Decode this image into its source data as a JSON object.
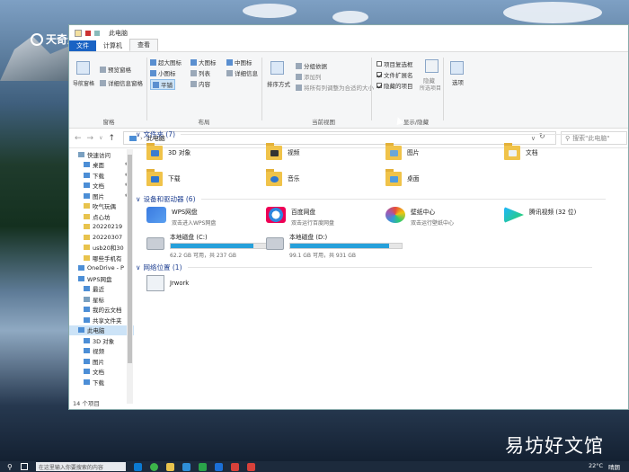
{
  "watermark_top": "天奇生活",
  "watermark_bottom": "易坊好文馆",
  "window": {
    "title": "此电脑",
    "tabs": [
      "文件",
      "计算机",
      "查看"
    ],
    "status": "14 个项目"
  },
  "ribbon": {
    "nav_pane": "导航窗格",
    "preview_pane": "预览窗格",
    "details_pane": "详细信息窗格",
    "group_panes": "窗格",
    "layouts": [
      "超大图标",
      "大图标",
      "中图标",
      "小图标",
      "列表",
      "详细信息",
      "平铺",
      "内容"
    ],
    "group_layout": "布局",
    "sort_by": "排序方式",
    "group_by": "分组依据",
    "add_columns": "添加列",
    "fit_columns": "将所有列调整为合适的大小",
    "group_current_view": "当前视图",
    "item_checkboxes": "项目复选框",
    "file_extensions": "文件扩展名",
    "hidden_items": "隐藏的项目",
    "hide_selected": "隐藏",
    "hide_selected_sub": "所选项目",
    "options": "选项",
    "group_show_hide": "显示/隐藏",
    "checks": {
      "item_checkboxes": false,
      "file_extensions": true,
      "hidden_items": true
    }
  },
  "address": {
    "path": "此电脑",
    "search_placeholder": "搜索\"此电脑\""
  },
  "sidebar": [
    {
      "label": "快速访问",
      "icon": "star-icon",
      "level": 1
    },
    {
      "label": "桌面",
      "icon": "desktop-icon",
      "level": 2,
      "pin": true
    },
    {
      "label": "下载",
      "icon": "download-icon",
      "level": 2,
      "pin": true
    },
    {
      "label": "文档",
      "icon": "document-icon",
      "level": 2,
      "pin": true
    },
    {
      "label": "图片",
      "icon": "picture-icon",
      "level": 2,
      "pin": true
    },
    {
      "label": "吹气玩偶",
      "icon": "folder-icon",
      "level": 2
    },
    {
      "label": "点心坊",
      "icon": "folder-icon",
      "level": 2
    },
    {
      "label": "20220219",
      "icon": "folder-icon",
      "level": 2
    },
    {
      "label": "20220307",
      "icon": "folder-icon",
      "level": 2
    },
    {
      "label": "usb20和30",
      "icon": "folder-icon",
      "level": 2
    },
    {
      "label": "哪些手机有",
      "icon": "folder-icon",
      "level": 2
    },
    {
      "label": "OneDrive - P",
      "icon": "cloud-icon",
      "level": 1
    },
    {
      "label": "WPS网盘",
      "icon": "cloud-icon",
      "level": 1
    },
    {
      "label": "最近",
      "icon": "clock-icon",
      "level": 2
    },
    {
      "label": "星标",
      "icon": "star-icon",
      "level": 2
    },
    {
      "label": "我的云文档",
      "icon": "cloud-doc-icon",
      "level": 2
    },
    {
      "label": "共享文件夹",
      "icon": "share-icon",
      "level": 2
    },
    {
      "label": "此电脑",
      "icon": "computer-icon",
      "level": 1,
      "selected": true
    },
    {
      "label": "3D 对象",
      "icon": "cube-icon",
      "level": 2
    },
    {
      "label": "视频",
      "icon": "video-icon",
      "level": 2
    },
    {
      "label": "图片",
      "icon": "picture-icon",
      "level": 2
    },
    {
      "label": "文档",
      "icon": "document-icon",
      "level": 2
    },
    {
      "label": "下载",
      "icon": "download-icon",
      "level": 2
    }
  ],
  "sections": {
    "folders": "文件夹 (7)",
    "devices": "设备和驱动器 (6)",
    "network": "网络位置 (1)"
  },
  "folders": [
    "3D 对象",
    "视频",
    "图片",
    "文档",
    "下载",
    "音乐",
    "桌面"
  ],
  "devices": [
    {
      "name": "WPS网盘",
      "sub": "双击进入WPS网盘"
    },
    {
      "name": "百度网盘",
      "sub": "双击运行百度网盘"
    },
    {
      "name": "壁纸中心",
      "sub": "双击运行壁纸中心"
    },
    {
      "name": "腾讯视频 (32 位)",
      "sub": ""
    }
  ],
  "drives": [
    {
      "name": "本地磁盘 (C:)",
      "sub": "62.2 GB 可用，共 237 GB",
      "used_fraction": 0.74
    },
    {
      "name": "本地磁盘 (D:)",
      "sub": "99.1 GB 可用，共 931 GB",
      "used_fraction": 0.89
    }
  ],
  "network_items": [
    "Jrwork"
  ],
  "taskbar": {
    "search": "在这里输入你要搜索的内容",
    "weather": "22°C",
    "status": "晴朗"
  }
}
